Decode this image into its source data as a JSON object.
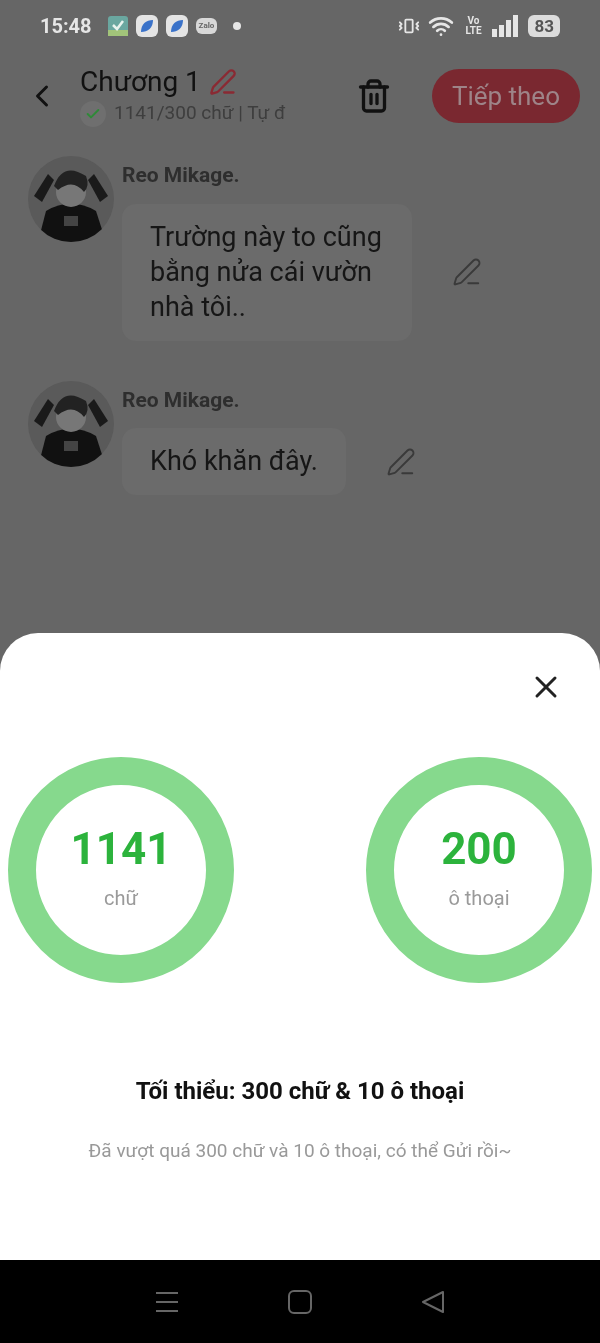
{
  "status_bar": {
    "time": "15:48",
    "app_icons": [
      {
        "kind": "check"
      },
      {
        "kind": "leaf"
      },
      {
        "kind": "leaf"
      },
      {
        "kind": "chat",
        "label": "Zalo"
      }
    ],
    "network": "Vo LTE",
    "battery": "83"
  },
  "header": {
    "title": "Chương 1",
    "word_count": "1141/300 chữ | Tự đ",
    "verified": true,
    "next_button": "Tiếp theo"
  },
  "messages": [
    {
      "author": "Reo Mikage.",
      "text": "Trường này to cũng bằng nửa cái vườn nhà tôi.."
    },
    {
      "author": "Reo Mikage.",
      "text": "Khó khăn đây."
    }
  ],
  "sheet": {
    "stats": [
      {
        "value": "1141",
        "unit": "chữ"
      },
      {
        "value": "200",
        "unit": "ô thoại"
      }
    ],
    "requirement": "Tối thiểu: 300 chữ & 10 ô thoại",
    "note": "Đã vượt quá 300 chữ và 10 ô thoại, có thể Gửi rồi~"
  }
}
